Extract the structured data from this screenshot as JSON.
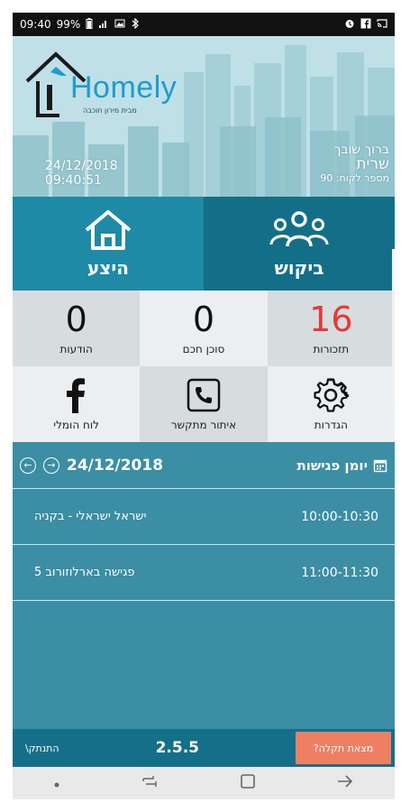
{
  "status_bar": {
    "time": "09:40",
    "battery": "99%",
    "icons_left": [
      "battery-icon",
      "signal-icon",
      "image-icon",
      "bluetooth-icon"
    ],
    "icons_right": [
      "alarm-icon",
      "facebook-icon",
      "cast-icon"
    ]
  },
  "header": {
    "logo_text": "Homely",
    "logo_tagline": "מבית מירון חוכבה",
    "date": "24/12/2018",
    "time": "09:40:51",
    "greeting": "ברוך שובך",
    "user_name": "שרית",
    "customer_number": "מספר לקוח: 90"
  },
  "big_tiles": {
    "offer": {
      "label": "היצע",
      "icon": "house-icon"
    },
    "demand": {
      "label": "ביקוש",
      "icon": "people-icon"
    }
  },
  "stats": {
    "reminders": {
      "count": "16",
      "label": "תזכורות"
    },
    "smart_agent": {
      "count": "0",
      "label": "סוכן חכם"
    },
    "messages": {
      "count": "0",
      "label": "הודעות"
    }
  },
  "actions": {
    "settings": {
      "label": "הגדרות",
      "icon": "gear-icon"
    },
    "caller_id": {
      "label": "איתור מתקשר",
      "icon": "phone-icon"
    },
    "homely_board": {
      "label": "לוח הומלי",
      "icon": "facebook-icon"
    }
  },
  "diary": {
    "title": "יומן פגישות",
    "date": "24/12/2018",
    "meetings": [
      {
        "time": "10:00-10:30",
        "title": "ישראל ישראלי - בקניה"
      },
      {
        "time": "11:00-11:30",
        "title": "פגישה בארלוזורוב 5"
      }
    ]
  },
  "bottom_bar": {
    "logout": "התנתק\\",
    "version": "2.5.5",
    "report_bug": "מצאת תקלה?"
  },
  "colors": {
    "offer_tile": "#1e8aa5",
    "demand_tile": "#136f88",
    "diary_bg": "#3b8ea3",
    "reminders_accent": "#e53935",
    "report_button": "#ef7f63"
  }
}
